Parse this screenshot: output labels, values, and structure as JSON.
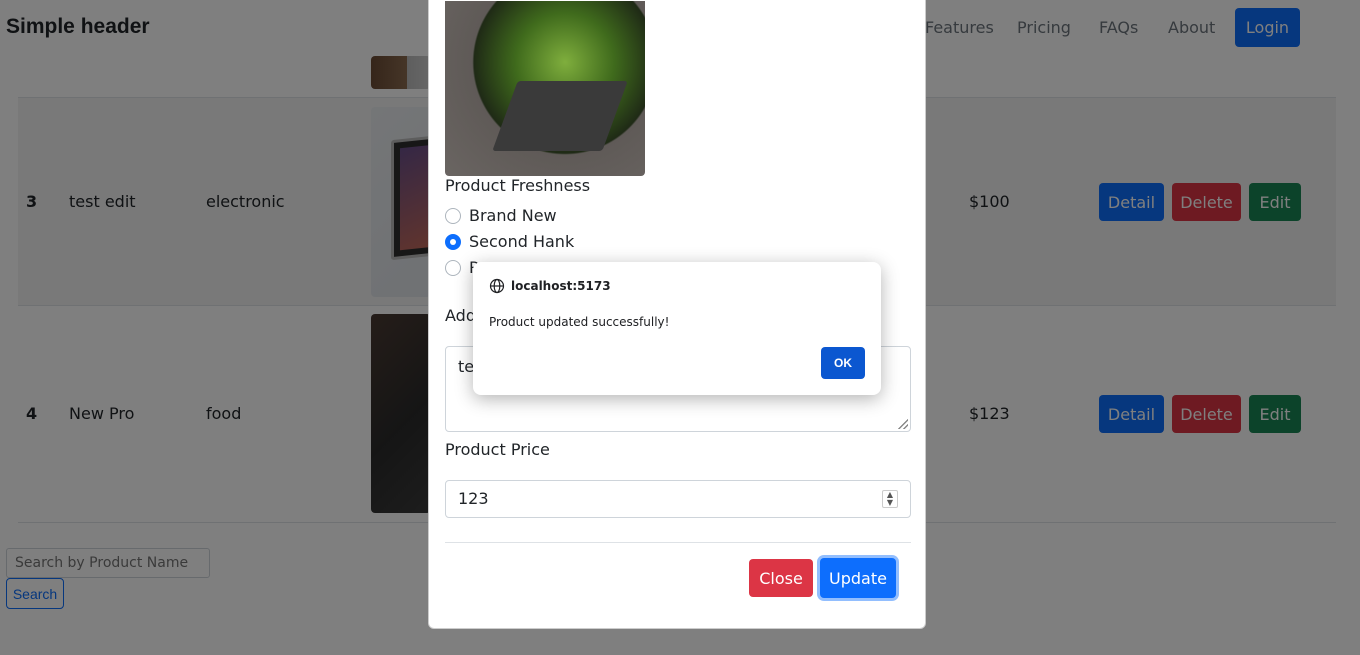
{
  "header": {
    "brand": "Simple header",
    "nav": [
      "Features",
      "Pricing",
      "FAQs",
      "About"
    ],
    "login_label": "Login"
  },
  "table": {
    "rows": [
      {
        "id": "3",
        "name": "test edit",
        "category": "electronic",
        "price": "$100"
      },
      {
        "id": "4",
        "name": "New Pro",
        "category": "food",
        "price": "$123"
      }
    ],
    "actions": {
      "detail": "Detail",
      "delete": "Delete",
      "edit": "Edit"
    }
  },
  "search": {
    "placeholder": "Search by Product Name",
    "button_label": "Search"
  },
  "modal": {
    "freshness_label": "Product Freshness",
    "freshness_options": [
      {
        "label": "Brand New",
        "checked": false
      },
      {
        "label": "Second Hank",
        "checked": true
      },
      {
        "label": "R",
        "checked": false
      }
    ],
    "additional_label": "Add",
    "textarea_value": "tes",
    "price_label": "Product Price",
    "price_value": "123",
    "close_label": "Close",
    "update_label": "Update"
  },
  "alert": {
    "origin": "localhost:5173",
    "message": "Product updated successfully!",
    "ok_label": "OK"
  },
  "colors": {
    "primary": "#0d6efd",
    "danger": "#dc3545",
    "success": "#198754",
    "dialog_button": "#0b57d0"
  }
}
